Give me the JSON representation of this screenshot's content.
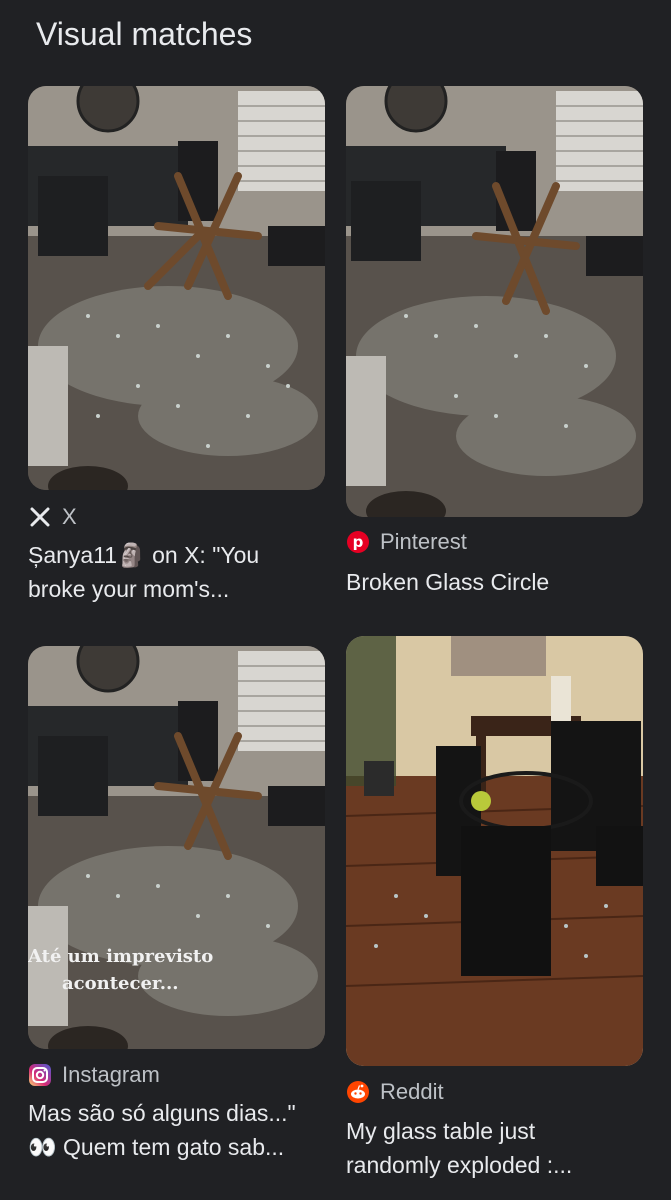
{
  "section": {
    "title": "Visual matches"
  },
  "results": [
    {
      "source_name": "X",
      "source_icon": "x-logo-icon",
      "caption_line1": "Șanya11🗿 on X: \"You",
      "caption_line2": "broke your mom's..."
    },
    {
      "source_name": "Pinterest",
      "source_icon": "pinterest-logo-icon",
      "caption_line1": "Broken Glass Circle",
      "caption_line2": ""
    },
    {
      "source_name": "Instagram",
      "source_icon": "instagram-logo-icon",
      "caption_line1": "Mas são só alguns dias...\"",
      "caption_line2": "👀 Quem tem gato sab...",
      "overlay_line1": "Até um imprevisto",
      "overlay_line2": "acontecer..."
    },
    {
      "source_name": "Reddit",
      "source_icon": "reddit-logo-icon",
      "caption_line1": "My glass table just",
      "caption_line2": "randomly exploded :..."
    }
  ]
}
